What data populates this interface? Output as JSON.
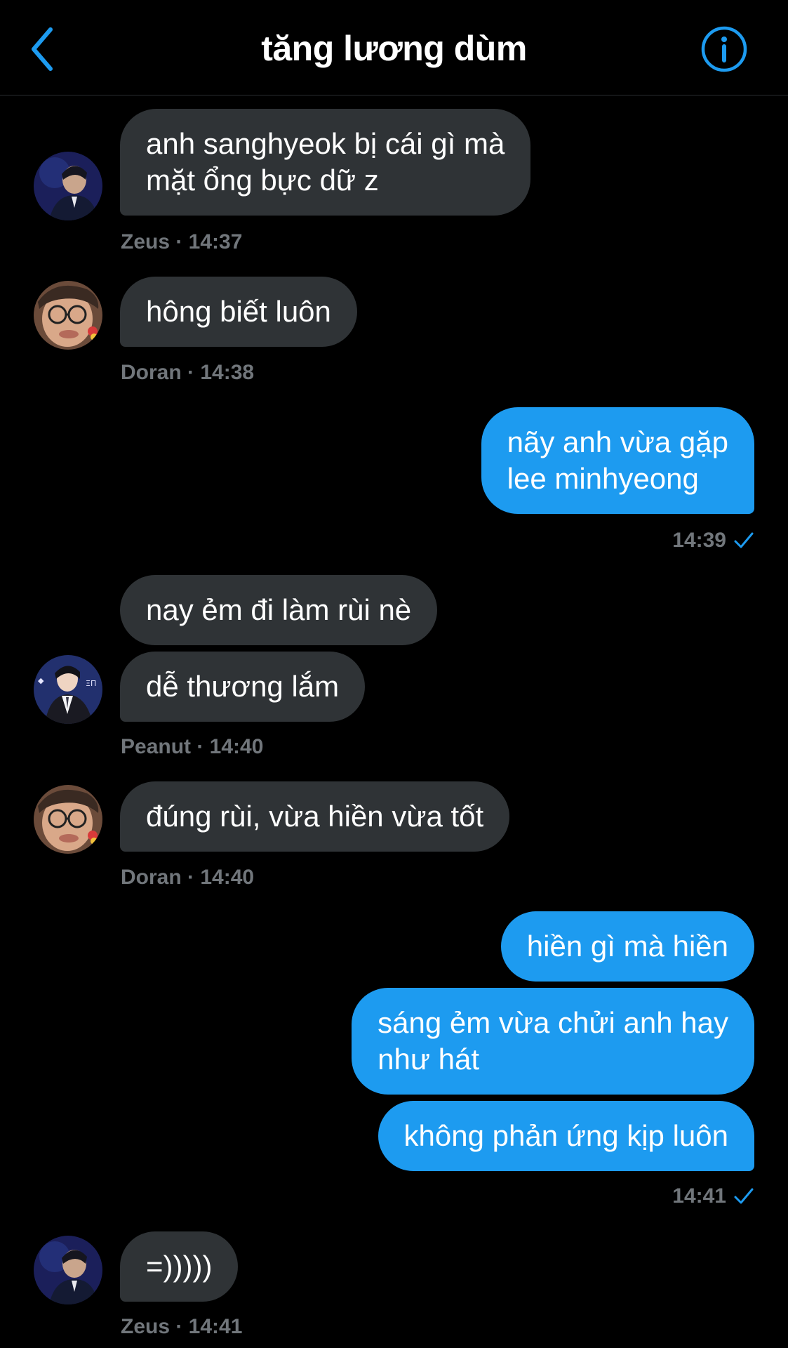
{
  "header": {
    "title": "tăng lương dùm",
    "back_icon": "chevron-left-icon",
    "info_icon": "info-icon",
    "accent_color": "#1d9bf0"
  },
  "colors": {
    "background": "#000000",
    "incoming_bubble": "#2f3336",
    "outgoing_bubble": "#1d9bf0",
    "meta_text": "#71767b"
  },
  "messages": [
    {
      "direction": "in",
      "sender": "Zeus",
      "lines": [
        "anh sanghyeok bị cái gì mà",
        "mặt ổng bực dữ z"
      ],
      "meta": "Zeus · 14:37"
    },
    {
      "direction": "in",
      "sender": "Doran",
      "lines": [
        "hông biết luôn"
      ],
      "meta": "Doran · 14:38"
    },
    {
      "direction": "out",
      "lines": [
        "nãy anh vừa gặp",
        "lee minhyeong"
      ],
      "meta": "14:39",
      "status_icon": "read-check-icon"
    },
    {
      "direction": "in",
      "sender": "Peanut",
      "lines": [
        "nay ẻm đi làm rùi nè"
      ]
    },
    {
      "direction": "in",
      "sender": "Peanut",
      "lines": [
        "dễ thương lắm"
      ],
      "meta": "Peanut · 14:40"
    },
    {
      "direction": "in",
      "sender": "Doran",
      "lines": [
        "đúng rùi, vừa hiền vừa tốt"
      ],
      "meta": "Doran · 14:40"
    },
    {
      "direction": "out",
      "lines": [
        "hiền gì mà hiền"
      ]
    },
    {
      "direction": "out",
      "lines": [
        "sáng ẻm vừa chửi anh hay",
        "như hát"
      ]
    },
    {
      "direction": "out",
      "lines": [
        "không phản ứng kịp luôn"
      ],
      "meta": "14:41",
      "status_icon": "read-check-icon"
    },
    {
      "direction": "in",
      "sender": "Zeus",
      "lines": [
        "=)))))"
      ],
      "meta": "Zeus · 14:41"
    }
  ]
}
